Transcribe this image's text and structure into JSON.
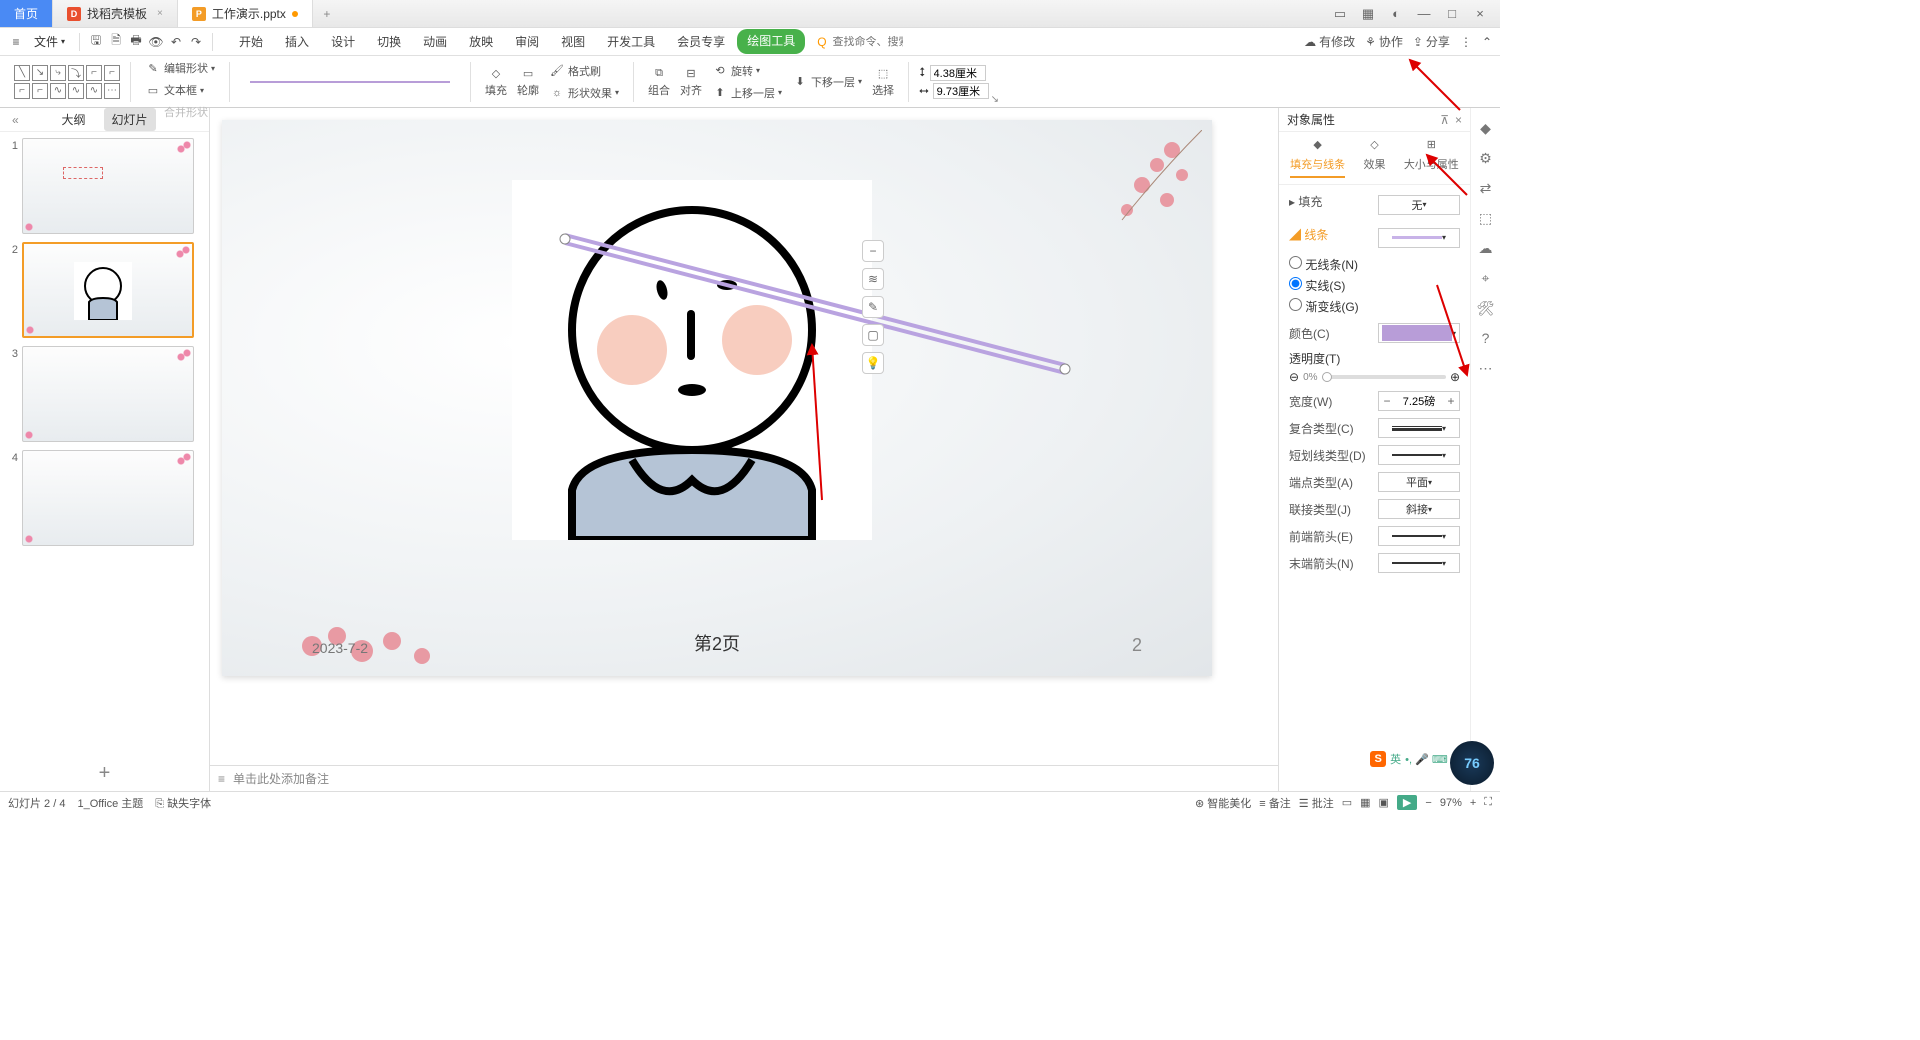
{
  "titlebar": {
    "tabs": [
      {
        "label": "首页"
      },
      {
        "label": "找稻壳模板"
      },
      {
        "label": "工作演示.pptx"
      }
    ],
    "win": {
      "min": "—",
      "max": "□",
      "close": "×"
    }
  },
  "menubar": {
    "file": "文件",
    "search_placeholder": "查找命令、搜索模板",
    "ribbon_tabs": [
      "开始",
      "插入",
      "设计",
      "切换",
      "动画",
      "放映",
      "审阅",
      "视图",
      "开发工具",
      "会员专享"
    ],
    "drawing_tool": "绘图工具",
    "right": {
      "pending": "有修改",
      "coop": "协作",
      "share": "分享"
    }
  },
  "ribbon": {
    "edit_shape": "编辑形状",
    "textbox": "文本框",
    "merge_shape": "合并形状",
    "fill": "填充",
    "outline": "轮廓",
    "effects": "形状效果",
    "format_painter": "格式刷",
    "group": "组合",
    "align": "对齐",
    "rotate": "旋转",
    "bring_fwd": "上移一层",
    "send_back": "下移一层",
    "select": "选择",
    "height": "4.38厘米",
    "width": "9.73厘米"
  },
  "sidebar": {
    "tabs": {
      "outline": "大纲",
      "slides": "幻灯片"
    },
    "nums": [
      "1",
      "2",
      "3",
      "4"
    ]
  },
  "slide": {
    "date": "2023-7-2",
    "page_center": "第2页",
    "page_right": "2"
  },
  "notes": {
    "placeholder": "单击此处添加备注"
  },
  "panel": {
    "title": "对象属性",
    "tabs": {
      "fill_line": "填充与线条",
      "effects": "效果",
      "size_prop": "大小与属性"
    },
    "fill": "填充",
    "fill_value": "无",
    "line": "线条",
    "line_options": {
      "none": "无线条(N)",
      "solid": "实线(S)",
      "gradient": "渐变线(G)"
    },
    "color": "颜色(C)",
    "transparency": "透明度(T)",
    "transparency_val": "0%",
    "width": "宽度(W)",
    "width_val": "7.25磅",
    "compound": "复合类型(C)",
    "dash": "短划线类型(D)",
    "cap": "端点类型(A)",
    "cap_val": "平面",
    "join": "联接类型(J)",
    "join_val": "斜接",
    "arrow_begin": "前端箭头(E)",
    "arrow_end": "末端箭头(N)"
  },
  "statusbar": {
    "slide_info": "幻灯片 2 / 4",
    "theme": "1_Office 主题",
    "missing_font": "缺失字体",
    "beautify": "智能美化",
    "notes_btn": "备注",
    "comments": "批注",
    "zoom": "97%",
    "ime": "英"
  },
  "hud": "76"
}
